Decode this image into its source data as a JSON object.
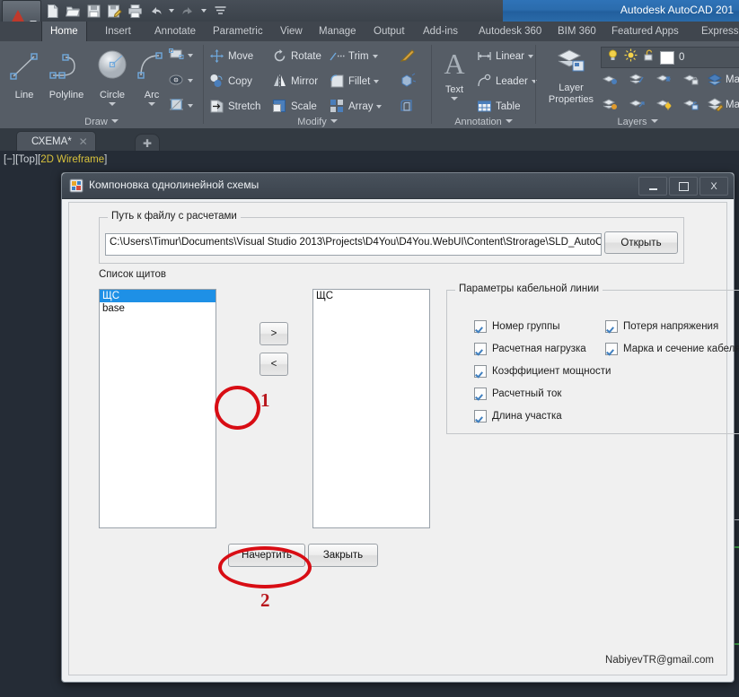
{
  "window": {
    "title": "Autodesk AutoCAD 201",
    "quick_access": [
      "new-icon",
      "open-icon",
      "save-icon",
      "save-as-icon",
      "plot-icon",
      "undo-icon",
      "redo-icon",
      "customize-icon"
    ]
  },
  "ribbon": {
    "tabs": [
      {
        "label": "Home",
        "active": true
      },
      {
        "label": "Insert",
        "active": false
      },
      {
        "label": "Annotate",
        "active": false
      },
      {
        "label": "Parametric",
        "active": false
      },
      {
        "label": "View",
        "active": false
      },
      {
        "label": "Manage",
        "active": false
      },
      {
        "label": "Output",
        "active": false
      },
      {
        "label": "Add-ins",
        "active": false
      },
      {
        "label": "Autodesk 360",
        "active": false
      },
      {
        "label": "BIM 360",
        "active": false
      },
      {
        "label": "Featured Apps",
        "active": false
      },
      {
        "label": "Express T",
        "active": false
      }
    ],
    "panels": {
      "draw": {
        "title": "Draw",
        "big_tools": [
          {
            "label": "Line",
            "icon": "line-icon"
          },
          {
            "label": "Polyline",
            "icon": "polyline-icon"
          },
          {
            "label": "Circle",
            "icon": "circle-icon"
          },
          {
            "label": "Arc",
            "icon": "arc-icon"
          }
        ],
        "small_tools": [
          {
            "icon": "rectangle-icon"
          },
          {
            "icon": "hatch-pattern-icon"
          },
          {
            "icon": "gradient-icon"
          }
        ]
      },
      "modify": {
        "title": "Modify",
        "tools": [
          {
            "label": "Move",
            "icon": "move-icon"
          },
          {
            "label": "Copy",
            "icon": "copy-icon"
          },
          {
            "label": "Stretch",
            "icon": "stretch-icon"
          },
          {
            "label": "Rotate",
            "icon": "rotate-icon"
          },
          {
            "label": "Mirror",
            "icon": "mirror-icon"
          },
          {
            "label": "Scale",
            "icon": "scale-icon"
          },
          {
            "label": "Trim",
            "icon": "trim-icon"
          },
          {
            "label": "Fillet",
            "icon": "fillet-icon"
          },
          {
            "label": "Array",
            "icon": "array-icon"
          }
        ],
        "extra_icons": [
          "explode-icon",
          "erase-icon",
          "offset-icon"
        ]
      },
      "annotation": {
        "title": "Annotation",
        "text_label": "Text",
        "tools": [
          {
            "label": "Linear",
            "icon": "linear-dimension-icon"
          },
          {
            "label": "Leader",
            "icon": "leader-icon"
          },
          {
            "label": "Table",
            "icon": "table-icon"
          }
        ]
      },
      "layers": {
        "title": "Layers",
        "properties_label_line1": "Layer",
        "properties_label_line2": "Properties",
        "current_layer": "0",
        "status_icons": [
          "lightbulb-icon",
          "sun-icon",
          "unlock-icon"
        ],
        "tools": [
          {
            "label": "Make C",
            "icon": "make-current-icon"
          },
          {
            "label": "Match",
            "icon": "layer-match-icon"
          }
        ]
      }
    }
  },
  "document": {
    "tab_label": "СХЕМА*",
    "close_glyph": "✕",
    "new_tab_glyph": "✚"
  },
  "canvas": {
    "viewport_label_prefix": "[−][Top][",
    "viewport_visual_style": "2D Wireframe",
    "viewport_label_suffix": "]"
  },
  "dialog": {
    "title": "Компоновка однолинейной схемы",
    "window_buttons": {
      "minimize": "—",
      "maximize": "□",
      "close": "X"
    },
    "path_group": {
      "label": "Путь к файлу с расчетами",
      "value": "C:\\Users\\Timur\\Documents\\Visual Studio 2013\\Projects\\D4You\\D4You.WebUI\\Content\\Strorage\\SLD_AutoCAD",
      "open_button": "Открыть"
    },
    "list_section": {
      "label": "Список щитов",
      "available_items": [
        {
          "text": "ЩС",
          "selected": true
        },
        {
          "text": "base",
          "selected": false
        }
      ],
      "selected_items": [
        {
          "text": "ЩС",
          "selected": false
        }
      ],
      "move_right_button": ">",
      "move_left_button": "<"
    },
    "params_group": {
      "label": "Параметры  кабельной линии",
      "column_left": [
        {
          "label": "Номер группы",
          "checked": true
        },
        {
          "label": "Расчетная нагрузка",
          "checked": true
        },
        {
          "label": "Коэффициент мощности",
          "checked": true
        },
        {
          "label": "Расчетный ток",
          "checked": true
        },
        {
          "label": "Длина участка",
          "checked": true
        }
      ],
      "column_right": [
        {
          "label": "Потеря напряжения",
          "checked": true
        },
        {
          "label": "Марка и сечение кабеля",
          "checked": true
        }
      ]
    },
    "actions": {
      "draw_button": "Начертить",
      "close_button": "Закрыть"
    },
    "footer_email": "NabiyevTR@gmail.com"
  },
  "annotations": [
    {
      "number": "1",
      "target": "move-right-button"
    },
    {
      "number": "2",
      "target": "draw-button"
    }
  ],
  "colors": {
    "accent_blue": "#1e90e6",
    "annotation_red": "#d80d14",
    "annotation_number_red": "#b8161c",
    "title_blue": "#2b6cad",
    "canvas_bg": "#252c36",
    "ribbon_bg": "#565d66",
    "dialog_bg": "#f0f0f0",
    "visual_style_yellow": "#d8c23c",
    "drawing_green": "#3fa34a"
  }
}
